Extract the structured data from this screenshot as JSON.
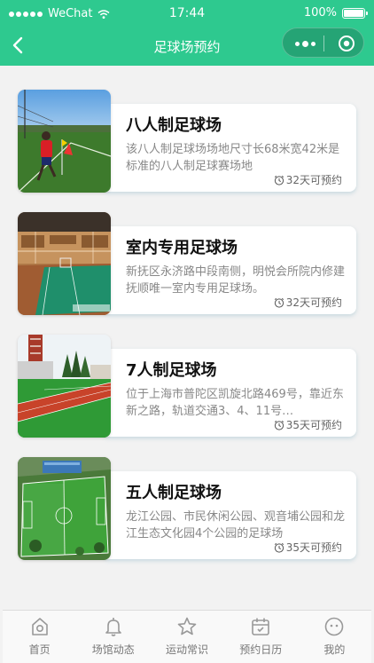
{
  "status_bar": {
    "carrier": "WeChat",
    "time": "17:44",
    "battery": "100%"
  },
  "navbar": {
    "title": "足球场预约"
  },
  "fields": [
    {
      "title": "八人制足球场",
      "description": "该八人制足球场场地尺寸长68米宽42米是标准的八人制足球赛场地",
      "availability": "32天可预约",
      "image": "outdoor-turf-with-player-photo"
    },
    {
      "title": "室内专用足球场",
      "description": "新抚区永济路中段南侧，明悦会所院内修建抚顺唯一室内专用足球场。",
      "availability": "32天可预约",
      "image": "indoor-arena-photo"
    },
    {
      "title": "7人制足球场",
      "description": "位于上海市普陀区凯旋北路469号，靠近东新之路，轨道交通3、4、11号…",
      "availability": "35天可预约",
      "image": "turf-with-running-track-photo"
    },
    {
      "title": "五人制足球场",
      "description": "龙江公园、市民休闲公园、观音埔公园和龙江生态文化园4个公园的足球场",
      "availability": "35天可预约",
      "image": "aerial-five-a-side-pitches-photo"
    }
  ],
  "tabbar": [
    {
      "label": "首页",
      "icon": "home-icon"
    },
    {
      "label": "场馆动态",
      "icon": "bell-icon"
    },
    {
      "label": "运动常识",
      "icon": "star-icon"
    },
    {
      "label": "预约日历",
      "icon": "calendar-icon"
    },
    {
      "label": "我的",
      "icon": "profile-icon"
    }
  ],
  "colors": {
    "header": "#2ec98f",
    "tab_inactive": "#777777"
  }
}
